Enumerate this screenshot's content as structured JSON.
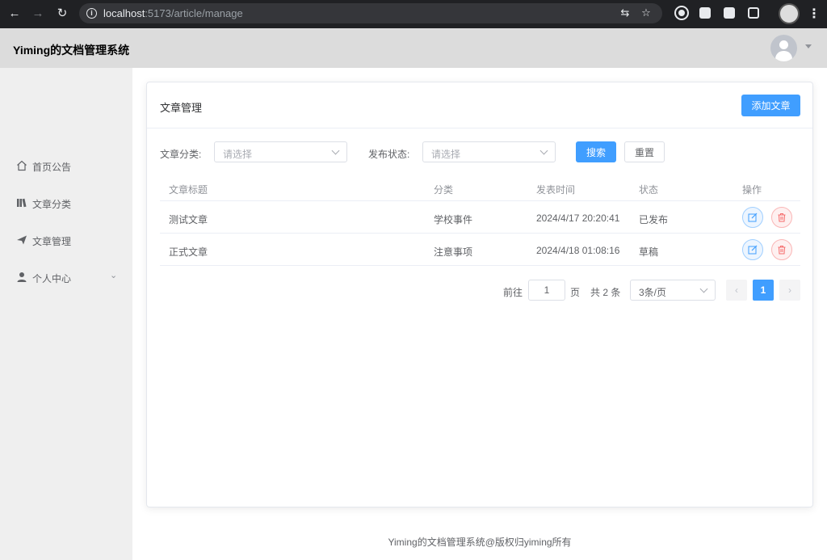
{
  "browser": {
    "url_host": "localhost",
    "url_path": ":5173/article/manage"
  },
  "app": {
    "title": "Yiming的文档管理系统"
  },
  "sidebar": {
    "items": [
      {
        "label": "首页公告",
        "icon": "home-icon"
      },
      {
        "label": "文章分类",
        "icon": "category-icon"
      },
      {
        "label": "文章管理",
        "icon": "send-icon"
      },
      {
        "label": "个人中心",
        "icon": "user-icon"
      }
    ]
  },
  "card": {
    "title": "文章管理",
    "add_button": "添加文章"
  },
  "filters": {
    "category_label": "文章分类:",
    "category_placeholder": "请选择",
    "status_label": "发布状态:",
    "status_placeholder": "请选择",
    "search_button": "搜索",
    "reset_button": "重置"
  },
  "table": {
    "headers": [
      "文章标题",
      "分类",
      "发表时间",
      "状态",
      "操作"
    ],
    "rows": [
      {
        "title": "测试文章",
        "category": "学校事件",
        "time": "2024/4/17 20:20:41",
        "status": "已发布"
      },
      {
        "title": "正式文章",
        "category": "注意事项",
        "time": "2024/4/18 01:08:16",
        "status": "草稿"
      }
    ]
  },
  "pagination": {
    "goto_prefix": "前往",
    "goto_value": "1",
    "goto_suffix": "页",
    "total": "共 2 条",
    "page_size": "3条/页",
    "current_page": "1"
  },
  "footer": {
    "text": "Yiming的文档管理系统@版权归yiming所有"
  },
  "colors": {
    "primary": "#409eff",
    "danger": "#f56c6c"
  }
}
